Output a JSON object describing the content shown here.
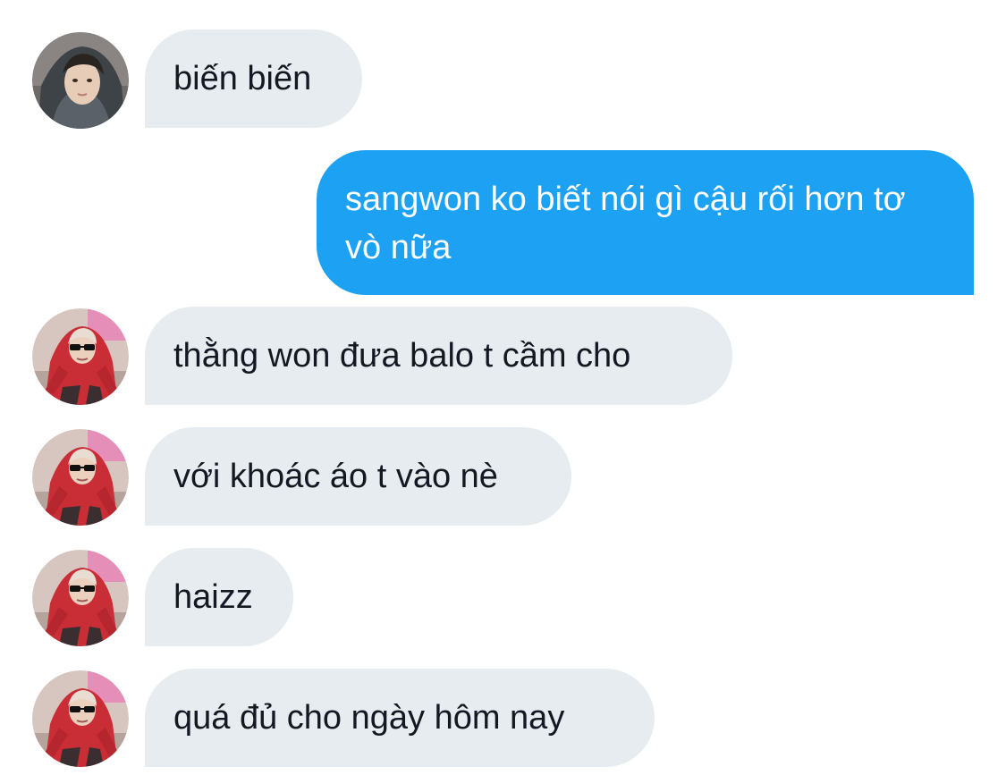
{
  "conversation": {
    "messages": [
      {
        "direction": "incoming",
        "text": "biến biến",
        "avatar": "avatar-hooded-person"
      },
      {
        "direction": "outgoing",
        "text": "sangwon ko biết nói gì cậu rối hơn tơ vò nữa"
      },
      {
        "direction": "incoming",
        "text": "thằng won đưa balo t cầm cho",
        "avatar": "avatar-red-hoodie-sunglasses"
      },
      {
        "direction": "incoming",
        "text": "với khoác áo t vào nè",
        "avatar": "avatar-red-hoodie-sunglasses"
      },
      {
        "direction": "incoming",
        "text": "haizz",
        "avatar": "avatar-red-hoodie-sunglasses"
      },
      {
        "direction": "incoming",
        "text": "quá đủ cho ngày hôm nay",
        "avatar": "avatar-red-hoodie-sunglasses"
      }
    ]
  },
  "colors": {
    "incoming_bubble": "#e6ecf0",
    "outgoing_bubble": "#1da1f2",
    "incoming_text": "#141823",
    "outgoing_text": "#ffffff"
  }
}
